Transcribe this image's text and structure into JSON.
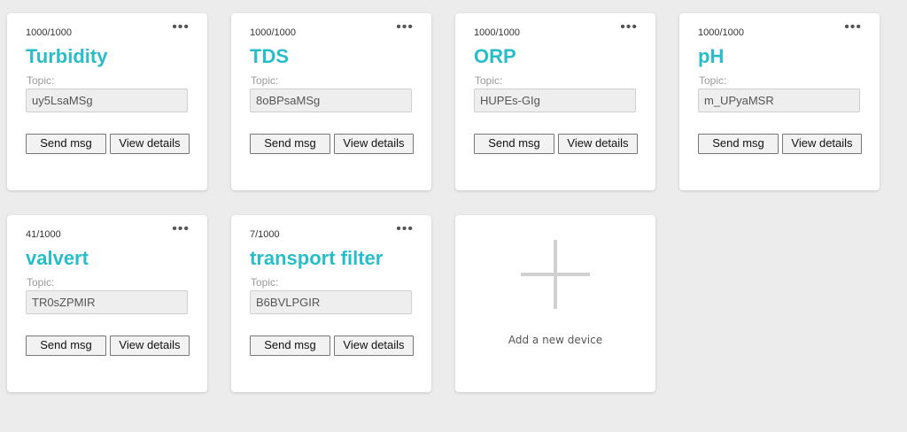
{
  "devices": [
    {
      "count": "1000/1000",
      "name": "Turbidity",
      "topic_label": "Topic:",
      "topic": "uy5LsaMSg",
      "send_label": "Send msg",
      "view_label": "View details",
      "menu_glyph": "•••"
    },
    {
      "count": "1000/1000",
      "name": "TDS",
      "topic_label": "Topic:",
      "topic": "8oBPsaMSg",
      "send_label": "Send msg",
      "view_label": "View details",
      "menu_glyph": "•••"
    },
    {
      "count": "1000/1000",
      "name": "ORP",
      "topic_label": "Topic:",
      "topic": "HUPEs-GIg",
      "send_label": "Send msg",
      "view_label": "View details",
      "menu_glyph": "•••"
    },
    {
      "count": "1000/1000",
      "name": "pH",
      "topic_label": "Topic:",
      "topic": "m_UPyaMSR",
      "send_label": "Send msg",
      "view_label": "View details",
      "menu_glyph": "•••"
    },
    {
      "count": "41/1000",
      "name": "valvert",
      "topic_label": "Topic:",
      "topic": "TR0sZPMIR",
      "send_label": "Send msg",
      "view_label": "View details",
      "menu_glyph": "•••"
    },
    {
      "count": "7/1000",
      "name": "transport filter",
      "topic_label": "Topic:",
      "topic": "B6BVLPGIR",
      "send_label": "Send msg",
      "view_label": "View details",
      "menu_glyph": "•••"
    }
  ],
  "add_device": {
    "label": "Add a new device",
    "icon": "plus-icon"
  },
  "colors": {
    "accent": "#28bdc7",
    "background": "#ececec",
    "card": "#ffffff"
  }
}
